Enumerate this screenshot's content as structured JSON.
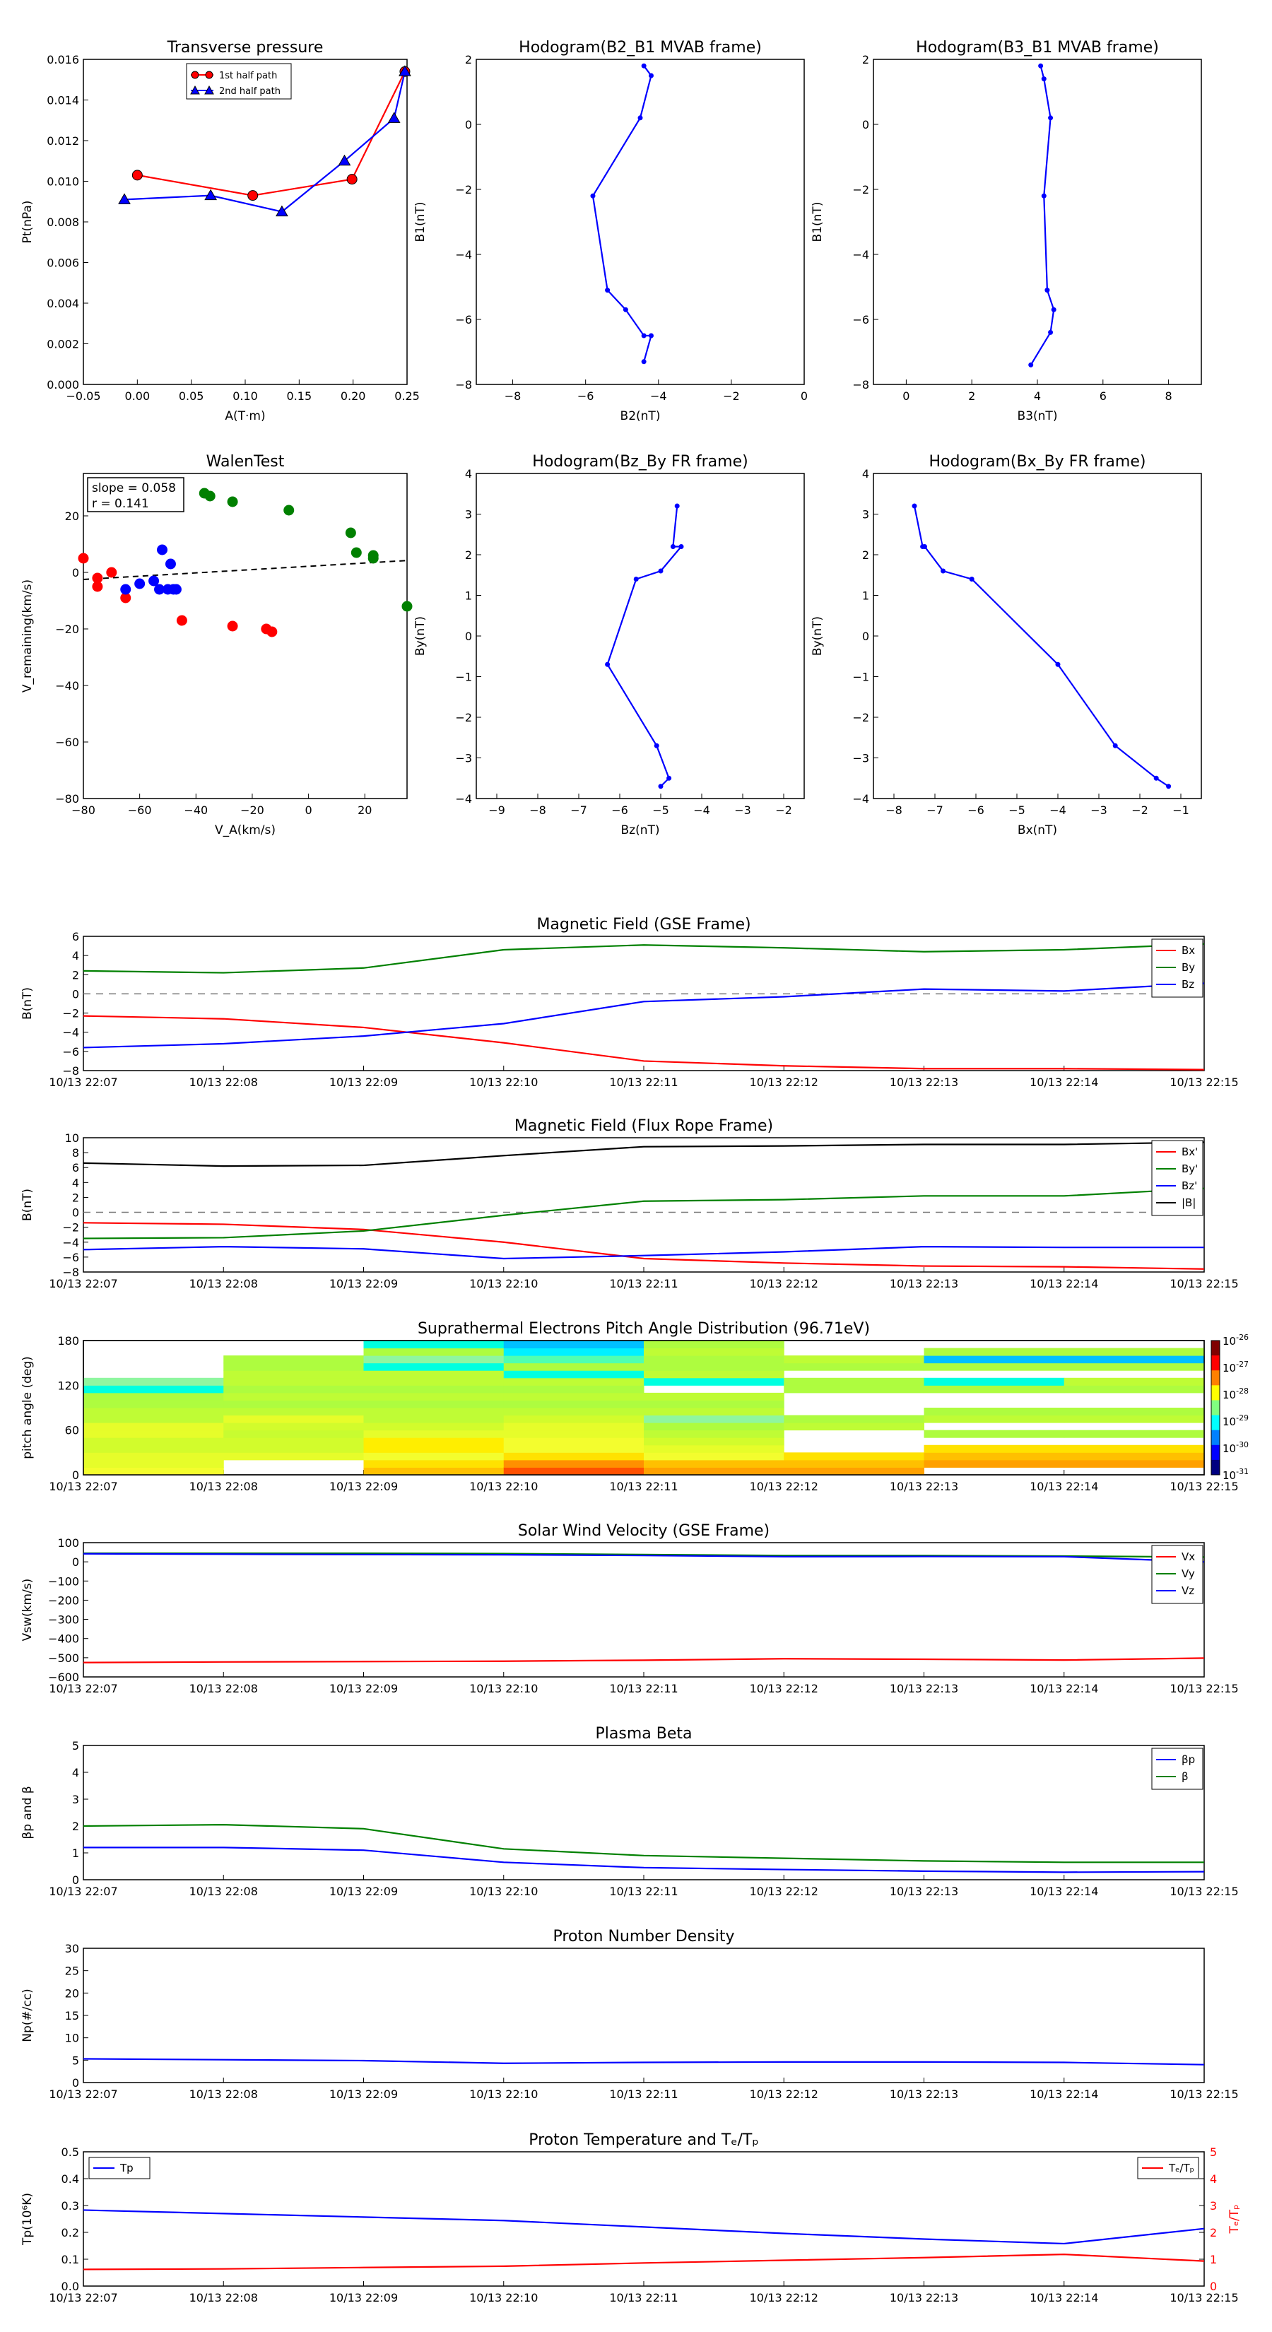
{
  "colors": {
    "red": "#ff0000",
    "green": "#008000",
    "blue": "#0000ff",
    "black": "#000000",
    "axis": "#000000"
  },
  "times": [
    "10/13 22:07",
    "10/13 22:08",
    "10/13 22:09",
    "10/13 22:10",
    "10/13 22:11",
    "10/13 22:12",
    "10/13 22:13",
    "10/13 22:14",
    "10/13 22:15"
  ],
  "chart_data": [
    {
      "id": "transverse-pressure",
      "type": "line",
      "title": "Transverse pressure",
      "xlabel": "A(T·m)",
      "ylabel": "Pt(nPa)",
      "xlim": [
        -0.05,
        0.25
      ],
      "ylim": [
        0,
        0.016
      ],
      "xticks": [
        -0.05,
        0.0,
        0.05,
        0.1,
        0.15,
        0.2,
        0.25
      ],
      "xtick_labels": [
        "−0.05",
        "0.00",
        "0.05",
        "0.10",
        "0.15",
        "0.20",
        "0.25"
      ],
      "yticks": [
        0,
        0.002,
        0.004,
        0.006,
        0.008,
        0.01,
        0.012,
        0.014,
        0.016
      ],
      "ytick_labels": [
        "0.000",
        "0.002",
        "0.004",
        "0.006",
        "0.008",
        "0.010",
        "0.012",
        "0.014",
        "0.016"
      ],
      "legend_position": "top-center",
      "series": [
        {
          "name": "1st half path",
          "marker": "circle",
          "color": "#ff0000",
          "x": [
            0.0,
            0.107,
            0.199,
            0.248
          ],
          "y": [
            0.0103,
            0.0093,
            0.0101,
            0.0154
          ]
        },
        {
          "name": "2nd half path",
          "marker": "triangle",
          "color": "#0000ff",
          "x": [
            -0.012,
            0.068,
            0.134,
            0.192,
            0.238,
            0.248
          ],
          "y": [
            0.0091,
            0.0093,
            0.0085,
            0.011,
            0.0131,
            0.0154
          ]
        }
      ]
    },
    {
      "id": "hodogram-b2-b1",
      "type": "line",
      "title": "Hodogram(B2_B1 MVAB frame)",
      "xlabel": "B2(nT)",
      "ylabel": "B1(nT)",
      "xlim": [
        -9,
        0
      ],
      "ylim": [
        -8,
        2
      ],
      "xticks": [
        -8,
        -6,
        -4,
        -2,
        0
      ],
      "xtick_labels": [
        "−8",
        "−6",
        "−4",
        "−2",
        "0"
      ],
      "yticks": [
        -8,
        -6,
        -4,
        -2,
        0,
        2
      ],
      "ytick_labels": [
        "−8",
        "−6",
        "−4",
        "−2",
        "0",
        "2"
      ],
      "series": [
        {
          "color": "#0000ff",
          "marker": "dot",
          "x": [
            -4.4,
            -4.2,
            -4.5,
            -5.8,
            -5.4,
            -4.9,
            -4.4,
            -4.2,
            -4.4
          ],
          "y": [
            1.8,
            1.5,
            0.2,
            -2.2,
            -5.1,
            -5.7,
            -6.5,
            -6.5,
            -7.3
          ]
        }
      ]
    },
    {
      "id": "hodogram-b3-b1",
      "type": "line",
      "title": "Hodogram(B3_B1 MVAB frame)",
      "xlabel": "B3(nT)",
      "ylabel": "B1(nT)",
      "xlim": [
        -1,
        9
      ],
      "ylim": [
        -8,
        2
      ],
      "xticks": [
        0,
        2,
        4,
        6,
        8
      ],
      "xtick_labels": [
        "0",
        "2",
        "4",
        "6",
        "8"
      ],
      "yticks": [
        -8,
        -6,
        -4,
        -2,
        0,
        2
      ],
      "ytick_labels": [
        "−8",
        "−6",
        "−4",
        "−2",
        "0",
        "2"
      ],
      "series": [
        {
          "color": "#0000ff",
          "marker": "dot",
          "x": [
            4.1,
            4.2,
            4.4,
            4.2,
            4.3,
            4.5,
            4.4,
            3.8
          ],
          "y": [
            1.8,
            1.4,
            0.2,
            -2.2,
            -5.1,
            -5.7,
            -6.4,
            -7.4
          ]
        }
      ]
    },
    {
      "id": "walen-test",
      "type": "scatter",
      "title": "WalenTest",
      "xlabel": "V_A(km/s)",
      "ylabel": "V_remaining(km/s)",
      "xlim": [
        -80,
        35
      ],
      "ylim": [
        -80,
        35
      ],
      "xticks": [
        -80,
        -60,
        -40,
        -20,
        0,
        20
      ],
      "xtick_labels": [
        "−80",
        "−60",
        "−40",
        "−20",
        "0",
        "20"
      ],
      "yticks": [
        -80,
        -60,
        -40,
        -20,
        0,
        20
      ],
      "ytick_labels": [
        "−80",
        "−60",
        "−40",
        "−20",
        "0",
        "20"
      ],
      "annotation": [
        "slope = 0.058",
        "r = 0.141"
      ],
      "fit_line": {
        "x": [
          -80,
          35
        ],
        "y": [
          -2.5,
          4.2
        ],
        "style": "dashed"
      },
      "series": [
        {
          "color": "#ff0000",
          "x": [
            -80,
            -75,
            -75,
            -70,
            -65,
            -45,
            -27,
            -15,
            -13
          ],
          "y": [
            5,
            -2,
            -5,
            0,
            -9,
            -17,
            -19,
            -20,
            -21
          ]
        },
        {
          "color": "#0000ff",
          "x": [
            -65,
            -60,
            -55,
            -53,
            -52,
            -50,
            -48,
            -49,
            -47
          ],
          "y": [
            -6,
            -4,
            -3,
            -6,
            8,
            -6,
            -6,
            3,
            -6
          ]
        },
        {
          "color": "#008000",
          "x": [
            -37,
            -35,
            -27,
            -7,
            15,
            17,
            23,
            23,
            35
          ],
          "y": [
            28,
            27,
            25,
            22,
            14,
            7,
            5,
            6,
            -12
          ]
        }
      ]
    },
    {
      "id": "hodogram-bz-by",
      "type": "line",
      "title": "Hodogram(Bz_By FR frame)",
      "xlabel": "Bz(nT)",
      "ylabel": "By(nT)",
      "xlim": [
        -9.5,
        -1.5
      ],
      "ylim": [
        -4,
        4
      ],
      "xticks": [
        -9,
        -8,
        -7,
        -6,
        -5,
        -4,
        -3,
        -2
      ],
      "xtick_labels": [
        "−9",
        "−8",
        "−7",
        "−6",
        "−5",
        "−4",
        "−3",
        "−2"
      ],
      "yticks": [
        -4,
        -3,
        -2,
        -1,
        0,
        1,
        2,
        3,
        4
      ],
      "ytick_labels": [
        "−4",
        "−3",
        "−2",
        "−1",
        "0",
        "1",
        "2",
        "3",
        "4"
      ],
      "series": [
        {
          "color": "#0000ff",
          "marker": "dot",
          "x": [
            -4.6,
            -4.7,
            -4.5,
            -5.0,
            -5.6,
            -6.3,
            -5.1,
            -4.8,
            -5.0
          ],
          "y": [
            3.2,
            2.2,
            2.2,
            1.6,
            1.4,
            -0.7,
            -2.7,
            -3.5,
            -3.7
          ]
        }
      ]
    },
    {
      "id": "hodogram-bx-by",
      "type": "line",
      "title": "Hodogram(Bx_By FR frame)",
      "xlabel": "Bx(nT)",
      "ylabel": "By(nT)",
      "xlim": [
        -8.5,
        -0.5
      ],
      "ylim": [
        -4,
        4
      ],
      "xticks": [
        -8,
        -7,
        -6,
        -5,
        -4,
        -3,
        -2,
        -1
      ],
      "xtick_labels": [
        "−8",
        "−7",
        "−6",
        "−5",
        "−4",
        "−3",
        "−2",
        "−1"
      ],
      "yticks": [
        -4,
        -3,
        -2,
        -1,
        0,
        1,
        2,
        3,
        4
      ],
      "ytick_labels": [
        "−4",
        "−3",
        "−2",
        "−1",
        "0",
        "1",
        "2",
        "3",
        "4"
      ],
      "series": [
        {
          "color": "#0000ff",
          "marker": "dot",
          "x": [
            -7.5,
            -7.3,
            -7.25,
            -6.8,
            -6.1,
            -4.0,
            -2.6,
            -1.6,
            -1.3
          ],
          "y": [
            3.2,
            2.2,
            2.2,
            1.6,
            1.4,
            -0.7,
            -2.7,
            -3.5,
            -3.7
          ]
        }
      ]
    },
    {
      "id": "magnetic-field-gse",
      "type": "line",
      "title": "Magnetic Field (GSE Frame)",
      "ylabel": "B(nT)",
      "ylim": [
        -8,
        6
      ],
      "yticks": [
        -8,
        -6,
        -4,
        -2,
        0,
        2,
        4,
        6
      ],
      "ytick_labels": [
        "−8",
        "−6",
        "−4",
        "−2",
        "0",
        "2",
        "4",
        "6"
      ],
      "zero_line": true,
      "legend_position": "right",
      "series": [
        {
          "name": "Bx",
          "color": "#ff0000",
          "values": [
            -2.3,
            -2.6,
            -3.5,
            -5.1,
            -7.0,
            -7.5,
            -7.8,
            -7.8,
            -7.9
          ]
        },
        {
          "name": "By",
          "color": "#008000",
          "values": [
            2.4,
            2.2,
            2.7,
            4.6,
            5.1,
            4.8,
            4.4,
            4.6,
            5.2
          ]
        },
        {
          "name": "Bz",
          "color": "#0000ff",
          "values": [
            -5.6,
            -5.2,
            -4.4,
            -3.1,
            -0.8,
            -0.3,
            0.5,
            0.3,
            1.1
          ]
        }
      ]
    },
    {
      "id": "magnetic-field-fr",
      "type": "line",
      "title": "Magnetic Field (Flux Rope Frame)",
      "ylabel": "B(nT)",
      "ylim": [
        -8,
        10
      ],
      "yticks": [
        -8,
        -6,
        -4,
        -2,
        0,
        2,
        4,
        6,
        8,
        10
      ],
      "ytick_labels": [
        "−8",
        "−6",
        "−4",
        "−2",
        "0",
        "2",
        "4",
        "6",
        "8",
        "10"
      ],
      "zero_line": true,
      "legend_position": "right",
      "series": [
        {
          "name": "Bx'",
          "color": "#ff0000",
          "values": [
            -1.4,
            -1.6,
            -2.3,
            -4.0,
            -6.2,
            -6.8,
            -7.2,
            -7.3,
            -7.6
          ]
        },
        {
          "name": "By'",
          "color": "#008000",
          "values": [
            -3.5,
            -3.4,
            -2.5,
            -0.4,
            1.5,
            1.7,
            2.2,
            2.2,
            3.2
          ]
        },
        {
          "name": "Bz'",
          "color": "#0000ff",
          "values": [
            -5.0,
            -4.6,
            -4.9,
            -6.2,
            -5.8,
            -5.3,
            -4.6,
            -4.7,
            -4.7
          ]
        },
        {
          "name": "|B|",
          "color": "#000000",
          "values": [
            6.6,
            6.2,
            6.3,
            7.6,
            8.8,
            8.9,
            9.1,
            9.1,
            9.4
          ]
        }
      ]
    },
    {
      "id": "pitch-angle",
      "type": "heatmap",
      "title": "Suprathermal Electrons Pitch Angle Distribution (96.71eV)",
      "ylabel": "pitch angle (deg)",
      "ylim": [
        0,
        180
      ],
      "yticks": [
        0,
        60,
        120,
        180
      ],
      "ytick_labels": [
        "0",
        "60",
        "120",
        "180"
      ],
      "colorbar_ticks": [
        "-26",
        "-27",
        "-28",
        "-29",
        "-30",
        "-31"
      ],
      "column_profiles": [
        [
          "#f3fd2e",
          "#e6fd2a",
          "#e6fd2a",
          "#d2fc2c",
          "#d2fc2c",
          "#e6fd2a",
          "#e6fd2a",
          "#bffc35",
          "#bffc35",
          "#aefc3f",
          "#aefc3f",
          "#00ffe0",
          "#8ff6a0",
          null,
          null,
          null,
          null,
          null
        ],
        [
          null,
          null,
          "#e6fd2a",
          "#d2fc2c",
          "#d2fc2c",
          "#c8fc30",
          "#d2fc2c",
          "#e6fd2a",
          "#bffc35",
          "#aefc3f",
          "#bffc35",
          "#aefc3f",
          "#bffc35",
          "#bffc35",
          "#aefc3f",
          "#aefc3f",
          null,
          null
        ],
        [
          "#ffc000",
          "#ffe200",
          "#f3fd2e",
          "#ffee00",
          "#ffee00",
          "#e6fd2a",
          "#d2fc2c",
          "#bffc35",
          "#bffc35",
          "#aefc3f",
          "#bffc35",
          "#aefc3f",
          "#bffc35",
          "#bffc35",
          "#00ffe0",
          "#8ff6a0",
          "#aefc3f",
          "#00ffe0"
        ],
        [
          "#ff5000",
          "#ff9000",
          "#ffe200",
          "#f3fd2e",
          "#f3fd2e",
          "#e6fd2a",
          "#e6fd2a",
          "#d2fc2c",
          "#bffc35",
          "#aefc3f",
          "#bffc35",
          "#aefc3f",
          "#bffc35",
          "#00ffe0",
          "#aefc3f",
          "#4fffb0",
          "#00f0ff",
          "#00c0ff"
        ],
        [
          "#ffa000",
          "#ffc000",
          "#f3fd2e",
          "#e6fd2a",
          "#d2fc2c",
          "#bffc35",
          "#aefc3f",
          "#8ff6a0",
          "#bffc35",
          "#aefc3f",
          "#bffc35",
          null,
          "#00ffe0",
          "#bffc35",
          "#aefc3f",
          "#aefc3f",
          "#bffc35",
          "#aefc3f"
        ],
        [
          "#ffa000",
          "#ffc000",
          "#ffe200",
          null,
          null,
          null,
          "#bffc35",
          "#aefc3f",
          null,
          null,
          null,
          "#aefc3f",
          "#aefc3f",
          null,
          "#aefc3f",
          "#bffc35",
          null,
          null
        ],
        [
          null,
          "#ffa000",
          "#ffc000",
          "#ffe200",
          null,
          "#aefc3f",
          null,
          "#bffc35",
          "#aefc3f",
          null,
          null,
          "#aefc3f",
          "#00ffe0",
          null,
          "#aefc3f",
          "#00c0ff",
          "#aefc3f",
          null
        ],
        [
          null,
          "#ffa000",
          "#ffc000",
          "#ffe200",
          null,
          "#aefc3f",
          null,
          "#bffc35",
          "#aefc3f",
          null,
          null,
          "#aefc3f",
          "#bffc35",
          null,
          "#aefc3f",
          "#00c0ff",
          "#aefc3f",
          null
        ]
      ]
    },
    {
      "id": "solar-wind-velocity",
      "type": "line",
      "title": "Solar Wind Velocity (GSE Frame)",
      "ylabel": "Vsw(km/s)",
      "ylim": [
        -600,
        100
      ],
      "yticks": [
        -600,
        -500,
        -400,
        -300,
        -200,
        -100,
        0,
        100
      ],
      "ytick_labels": [
        "−600",
        "−500",
        "−400",
        "−300",
        "−200",
        "−100",
        "0",
        "100"
      ],
      "legend_position": "right",
      "series": [
        {
          "name": "Vx",
          "color": "#ff0000",
          "values": [
            -525,
            -522,
            -520,
            -518,
            -513,
            -505,
            -508,
            -512,
            -502
          ]
        },
        {
          "name": "Vy",
          "color": "#008000",
          "values": [
            45,
            45,
            45,
            43,
            38,
            33,
            33,
            30,
            25
          ]
        },
        {
          "name": "Vz",
          "color": "#0000ff",
          "values": [
            42,
            40,
            38,
            37,
            33,
            27,
            28,
            27,
            0
          ]
        }
      ]
    },
    {
      "id": "plasma-beta",
      "type": "line",
      "title": "Plasma Beta",
      "ylabel": "βp and β",
      "ylim": [
        0,
        5
      ],
      "yticks": [
        0,
        1,
        2,
        3,
        4,
        5
      ],
      "ytick_labels": [
        "0",
        "1",
        "2",
        "3",
        "4",
        "5"
      ],
      "legend_position": "right",
      "series": [
        {
          "name": "βp",
          "color": "#0000ff",
          "values": [
            1.2,
            1.2,
            1.1,
            0.65,
            0.45,
            0.38,
            0.32,
            0.28,
            0.3
          ]
        },
        {
          "name": "β",
          "color": "#008000",
          "values": [
            2.0,
            2.05,
            1.9,
            1.15,
            0.9,
            0.8,
            0.7,
            0.65,
            0.65
          ]
        }
      ]
    },
    {
      "id": "proton-density",
      "type": "line",
      "title": "Proton Number Density",
      "ylabel": "Np(#/cc)",
      "ylim": [
        0,
        30
      ],
      "yticks": [
        0,
        5,
        10,
        15,
        20,
        25,
        30
      ],
      "ytick_labels": [
        "0",
        "5",
        "10",
        "15",
        "20",
        "25",
        "30"
      ],
      "series": [
        {
          "color": "#0000ff",
          "values": [
            5.3,
            5.1,
            4.9,
            4.3,
            4.5,
            4.6,
            4.6,
            4.5,
            4.0
          ]
        }
      ]
    },
    {
      "id": "proton-temperature",
      "type": "line",
      "title": "Proton Temperature and Tₑ/Tₚ",
      "ylabel": "Tp(10⁶K)",
      "ylabel_right": "Tₑ/Tₚ",
      "ylim": [
        0,
        0.5
      ],
      "ylim_right": [
        0,
        5
      ],
      "yticks": [
        0,
        0.1,
        0.2,
        0.3,
        0.4,
        0.5
      ],
      "ytick_labels": [
        "0.0",
        "0.1",
        "0.2",
        "0.3",
        "0.4",
        "0.5"
      ],
      "yticks_right": [
        0,
        1,
        2,
        3,
        4,
        5
      ],
      "ytick_labels_right": [
        "0",
        "1",
        "2",
        "3",
        "4",
        "5"
      ],
      "series": [
        {
          "name": "Tp",
          "color": "#0000ff",
          "axis": "left",
          "values": [
            0.283,
            0.27,
            0.257,
            0.244,
            0.22,
            0.196,
            0.175,
            0.158,
            0.214
          ],
          "legend_position": "top-left"
        },
        {
          "name": "Tₑ/Tₚ",
          "color": "#ff0000",
          "axis": "right",
          "values": [
            0.62,
            0.64,
            0.69,
            0.74,
            0.86,
            0.96,
            1.06,
            1.18,
            0.93
          ],
          "legend_position": "top-right"
        }
      ]
    }
  ]
}
